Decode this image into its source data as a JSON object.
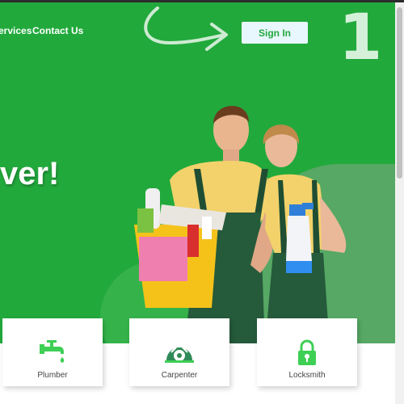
{
  "nav": {
    "services_label": "ervices",
    "contact_label": "Contact Us",
    "sign_in_label": "Sign In"
  },
  "hero": {
    "headline_fragment": "ver!",
    "step_number": "1"
  },
  "services": [
    {
      "label": "Plumber",
      "icon": "faucet-icon"
    },
    {
      "label": "Carpenter",
      "icon": "saw-icon"
    },
    {
      "label": "Locksmith",
      "icon": "lock-icon"
    }
  ],
  "colors": {
    "brand_green": "#22a93c",
    "sign_in_bg": "#e8f6fd",
    "card_icon_green": "#3ecf55"
  }
}
